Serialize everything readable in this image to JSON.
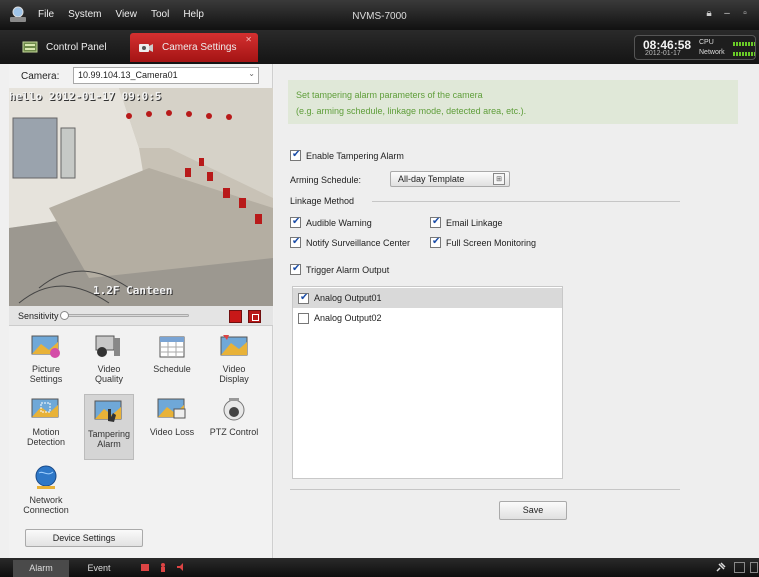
{
  "window": {
    "title": "NVMS-7000",
    "menu": [
      "File",
      "System",
      "View",
      "Tool",
      "Help"
    ],
    "controls": [
      "lock-icon",
      "minimize-icon",
      "restore-icon"
    ]
  },
  "tabs": {
    "control_panel": "Control Panel",
    "camera_settings": "Camera Settings",
    "active": "Camera Settings"
  },
  "clock": {
    "time": "08:46:58",
    "date": "2012-01-17",
    "cpu_label": "CPU",
    "network_label": "Network"
  },
  "left_panel": {
    "camera_label": "Camera:",
    "camera_value": "10.99.104.13_Camera01",
    "video_osd_top": "hello 2012-01-17 09:0:5",
    "video_osd_bottom": "1.2F Canteen",
    "sensitivity_label": "Sensitivity",
    "sensitivity_level": 0.0,
    "tiles": [
      {
        "label": "Picture Settings",
        "icon": "picture-settings-icon"
      },
      {
        "label": "Video Quality",
        "icon": "video-quality-icon"
      },
      {
        "label": "Schedule",
        "icon": "schedule-icon"
      },
      {
        "label": "Video Display",
        "icon": "video-display-icon"
      },
      {
        "label": "Motion Detection",
        "icon": "motion-detection-icon"
      },
      {
        "label": "Tampering Alarm",
        "icon": "tampering-alarm-icon"
      },
      {
        "label": "Video Loss",
        "icon": "video-loss-icon"
      },
      {
        "label": "PTZ Control",
        "icon": "ptz-control-icon"
      },
      {
        "label": "Network Connection",
        "icon": "network-connection-icon"
      }
    ],
    "selected_tile": "Tampering Alarm",
    "device_settings": "Device Settings"
  },
  "content": {
    "info_line1": "Set tampering alarm parameters of the camera",
    "info_line2": "(e.g. arming schedule, linkage mode, detected area, etc.).",
    "enable_label": "Enable Tampering Alarm",
    "enable_checked": true,
    "arming_label": "Arming Schedule:",
    "arming_value": "All-day Template",
    "linkage_label": "Linkage Method",
    "linkage": {
      "audible_warning": {
        "label": "Audible Warning",
        "checked": true
      },
      "email_linkage": {
        "label": "Email Linkage",
        "checked": true
      },
      "notify_center": {
        "label": "Notify Surveillance Center",
        "checked": true
      },
      "full_screen": {
        "label": "Full Screen Monitoring",
        "checked": true
      }
    },
    "trigger_label": "Trigger Alarm Output",
    "trigger_checked": true,
    "outputs": [
      {
        "label": "Analog Output01",
        "checked": true
      },
      {
        "label": "Analog Output02",
        "checked": false
      }
    ],
    "save_label": "Save"
  },
  "status_bar": {
    "alarm_tab": "Alarm",
    "event_tab": "Event"
  },
  "colors": {
    "accent_red": "#c81818",
    "info_text": "#5f9e3a",
    "check_blue": "#1c4ea8"
  }
}
